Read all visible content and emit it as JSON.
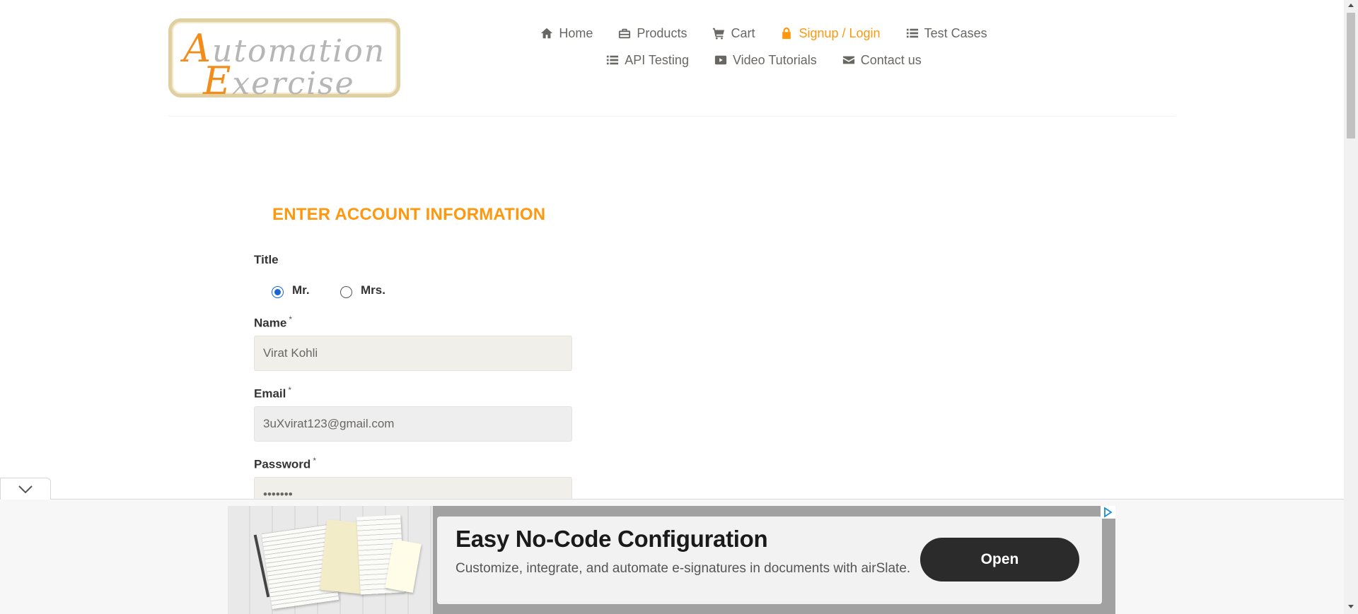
{
  "logo": {
    "line1_initial": "A",
    "line1_rest": "utomation",
    "line2_initial": "E",
    "line2_rest": "xercise"
  },
  "nav": {
    "items": [
      {
        "label": "Home",
        "icon": "home-icon"
      },
      {
        "label": "Products",
        "icon": "briefcase-icon"
      },
      {
        "label": "Cart",
        "icon": "cart-icon"
      },
      {
        "label": "Signup / Login",
        "icon": "lock-icon",
        "active": true
      },
      {
        "label": "Test Cases",
        "icon": "list-icon"
      },
      {
        "label": "API Testing",
        "icon": "list-icon"
      },
      {
        "label": "Video Tutorials",
        "icon": "youtube-icon"
      },
      {
        "label": "Contact us",
        "icon": "envelope-icon"
      }
    ]
  },
  "form": {
    "heading": "ENTER ACCOUNT INFORMATION",
    "title_label": "Title",
    "title_options": [
      {
        "label": "Mr.",
        "checked": true
      },
      {
        "label": "Mrs.",
        "checked": false
      }
    ],
    "name_label": "Name",
    "name_value": "Virat Kohli",
    "email_label": "Email",
    "email_value": "3uXvirat123@gmail.com",
    "password_label": "Password",
    "password_value": "•••••••",
    "required_mark": "*"
  },
  "ad": {
    "headline": "Easy No-Code Configuration",
    "body": "Customize, integrate, and automate e-signatures in documents with airSlate.",
    "cta": "Open"
  },
  "colors": {
    "accent": "#fe980f",
    "text": "#696763",
    "field_bg": "#f0efe9",
    "cta_bg": "#2b2b2b"
  }
}
